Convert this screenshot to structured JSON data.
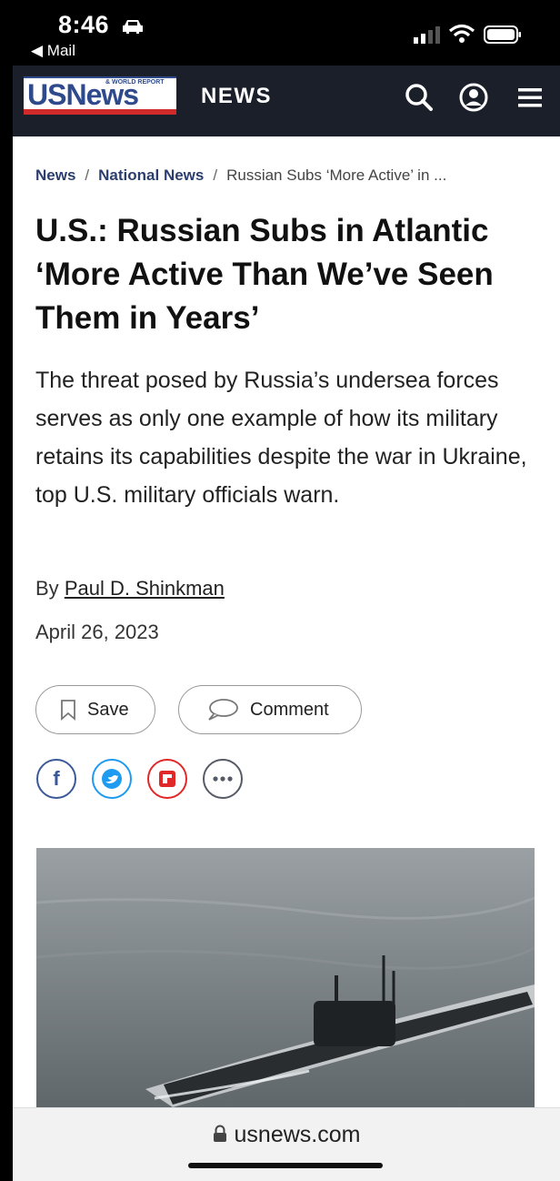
{
  "status_bar": {
    "time": "8:46",
    "back_app": "◀ Mail"
  },
  "header": {
    "logo_text": "USNews",
    "logo_subtext": "& WORLD REPORT",
    "section": "NEWS",
    "icons": [
      "search-icon",
      "account-icon",
      "menu-icon"
    ]
  },
  "breadcrumb": {
    "items": [
      "News",
      "National News"
    ],
    "current": "Russian Subs ‘More Active’ in ..."
  },
  "article": {
    "headline": "U.S.: Russian Subs in Atlantic ‘More Active Than We’ve Seen Them in Years’",
    "dek": "The threat posed by Russia’s undersea forces serves as only one example of how its military retains its capabilities despite the war in Ukraine, top U.S. military officials warn.",
    "byline_prefix": "By",
    "author": "Paul D. Shinkman",
    "date": "April 26, 2023"
  },
  "actions": {
    "save_label": "Save",
    "comment_label": "Comment"
  },
  "share": [
    {
      "name": "facebook",
      "color": "#3b5998"
    },
    {
      "name": "twitter",
      "color": "#1d9bf0"
    },
    {
      "name": "flipboard",
      "color": "#e12828"
    },
    {
      "name": "more",
      "color": "#555a66"
    }
  ],
  "browser": {
    "url": "usnews.com"
  },
  "colors": {
    "navbar": "#1b1f2a",
    "logo_blue": "#2e4a8c",
    "logo_red": "#d12a2a",
    "link": "#2c3e6e"
  }
}
